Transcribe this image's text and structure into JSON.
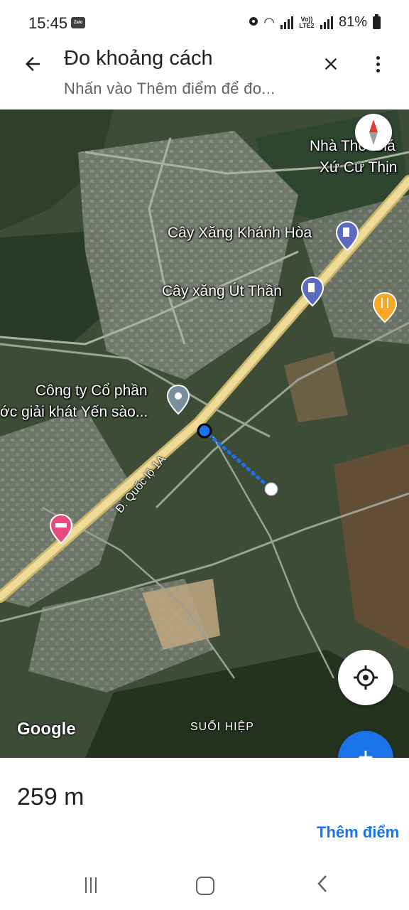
{
  "status_bar": {
    "time": "15:45",
    "zalo_label": "Zalo",
    "volte_label": "Vo)) LTE2",
    "battery_percent": "81%"
  },
  "app_bar": {
    "title": "Đo khoảng cách",
    "subtitle": "Nhấn vào Thêm điểm để đo..."
  },
  "map": {
    "labels": {
      "church": "Nhà Thờ Giáo Xứ Cư Thịnh",
      "church_line1": "Nhà Thờ Giá",
      "church_line2": "Xứ Cư Thịn",
      "gas_station_1": "Cây Xăng Khánh Hòa",
      "gas_station_2": "Cây xăng Út Thần",
      "company_line1": "Công ty Cổ phần",
      "company_line2": "ớc giải khát Yến sào...",
      "road": "Đ. Quốc lộ 1A",
      "district": "SUỐI HIỆP",
      "google": "Google"
    },
    "measure_line_color": "#1a73e8",
    "highway_color": "#e8d28a"
  },
  "measurement": {
    "distance": "259 m",
    "add_point": "Thêm điểm"
  }
}
